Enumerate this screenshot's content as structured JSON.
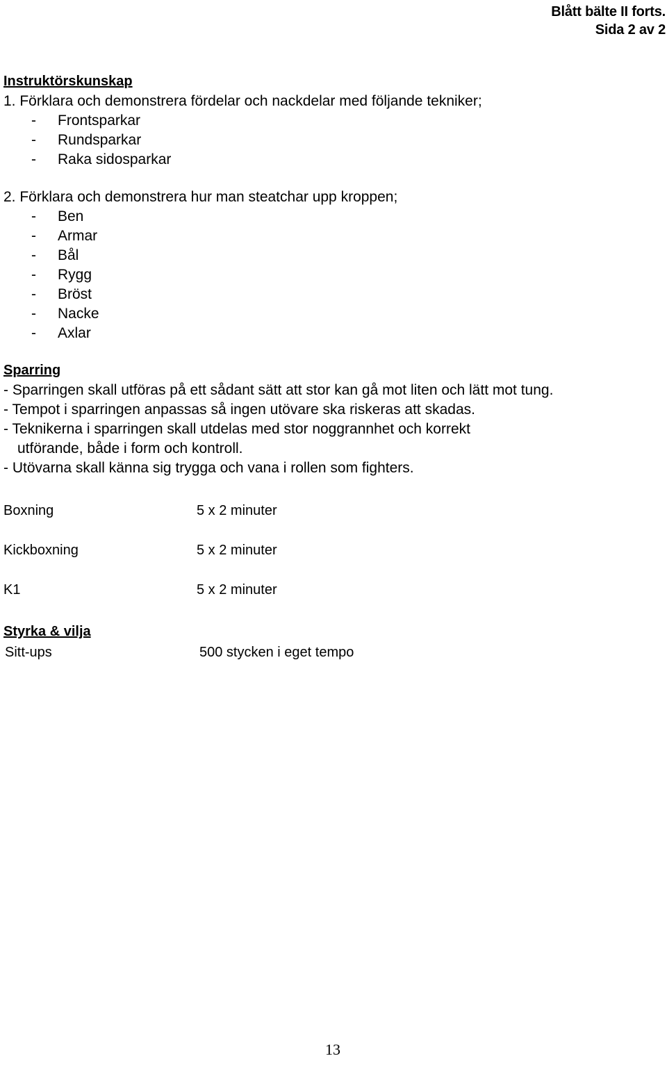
{
  "header": {
    "title": "Blått bälte II forts.",
    "page_of": "Sida 2 av 2"
  },
  "sections": {
    "instructor": {
      "heading": "Instruktörskunskap",
      "item1": {
        "text": "1. Förklara och demonstrera fördelar och nackdelar med följande tekniker;",
        "bullets": [
          {
            "dash": "-",
            "label": "Frontsparkar"
          },
          {
            "dash": "-",
            "label": "Rundsparkar"
          },
          {
            "dash": "-",
            "label": "Raka sidosparkar"
          }
        ]
      },
      "item2": {
        "text": "2. Förklara och demonstrera hur man steatchar upp kroppen;",
        "bullets": [
          {
            "dash": "-",
            "label": "Ben"
          },
          {
            "dash": "-",
            "label": "Armar"
          },
          {
            "dash": "-",
            "label": "Bål"
          },
          {
            "dash": "-",
            "label": "Rygg"
          },
          {
            "dash": "-",
            "label": "Bröst"
          },
          {
            "dash": "-",
            "label": "Nacke"
          },
          {
            "dash": "-",
            "label": "Axlar"
          }
        ]
      }
    },
    "sparring": {
      "heading": "Sparring",
      "lines": [
        "- Sparringen skall utföras på ett sådant sätt att stor kan gå mot liten och lätt mot tung.",
        "- Tempot i sparringen anpassas så ingen utövare ska riskeras att skadas.",
        "- Teknikerna i sparringen skall utdelas med stor noggrannhet och korrekt"
      ],
      "continuation": "utförande, både i form och kontroll.",
      "last_line": "- Utövarna skall känna sig trygga och vana i rollen som fighters.",
      "rows": [
        {
          "key": "Boxning",
          "value": "5 x 2 minuter"
        },
        {
          "key": "Kickboxning",
          "value": "5 x 2 minuter"
        },
        {
          "key": "K1",
          "value": "5 x 2 minuter"
        }
      ]
    },
    "strength": {
      "heading": "Styrka & vilja",
      "rows": [
        {
          "key": "Sitt-ups",
          "value": "500 stycken i eget tempo"
        }
      ]
    }
  },
  "footer": {
    "page_number": "13"
  }
}
